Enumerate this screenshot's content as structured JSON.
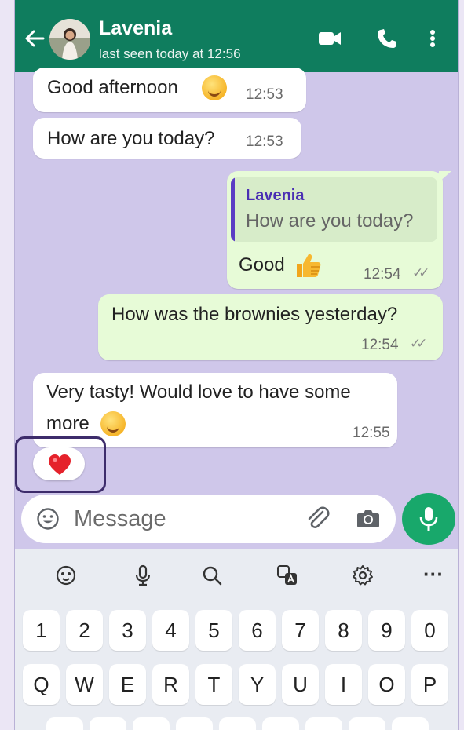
{
  "header": {
    "contact_name": "Lavenia",
    "last_seen": "last seen today at 12:56"
  },
  "messages": [
    {
      "direction": "incoming",
      "text": "Good afternoon",
      "emoji": "smiling-face-emoji",
      "time": "12:53"
    },
    {
      "direction": "incoming",
      "text": "How are you today?",
      "time": "12:53"
    },
    {
      "direction": "outgoing",
      "quoted_name": "Lavenia",
      "quoted_text": "How are you today?",
      "text": "Good",
      "emoji": "thumbs-up-emoji",
      "time": "12:54",
      "status": "read"
    },
    {
      "direction": "outgoing",
      "text": "How was the brownies yesterday?",
      "time": "12:54",
      "status": "read"
    },
    {
      "direction": "incoming",
      "text_line1": "Very tasty! Would love to have some",
      "text_line2": "more",
      "emoji": "face-savoring-food-emoji",
      "time": "12:55",
      "reaction": "red-heart-emoji"
    }
  ],
  "input": {
    "placeholder": "Message"
  },
  "keyboard": {
    "toolbar_icons": [
      "emoji-sticker-icon",
      "voice-input-icon",
      "search-icon",
      "translate-icon",
      "settings-icon",
      "more-icon"
    ],
    "number_row": [
      "1",
      "2",
      "3",
      "4",
      "5",
      "6",
      "7",
      "8",
      "9",
      "0"
    ],
    "letter_row": [
      "Q",
      "W",
      "E",
      "R",
      "T",
      "Y",
      "U",
      "I",
      "O",
      "P"
    ],
    "more_label": "···"
  },
  "colors": {
    "header": "#0f7d5e",
    "chat_background": "#cfc7ea",
    "incoming_bubble": "#ffffff",
    "outgoing_bubble": "#e7fbd7",
    "mic_button": "#18a86b",
    "highlight_box": "#3d2c6b"
  }
}
